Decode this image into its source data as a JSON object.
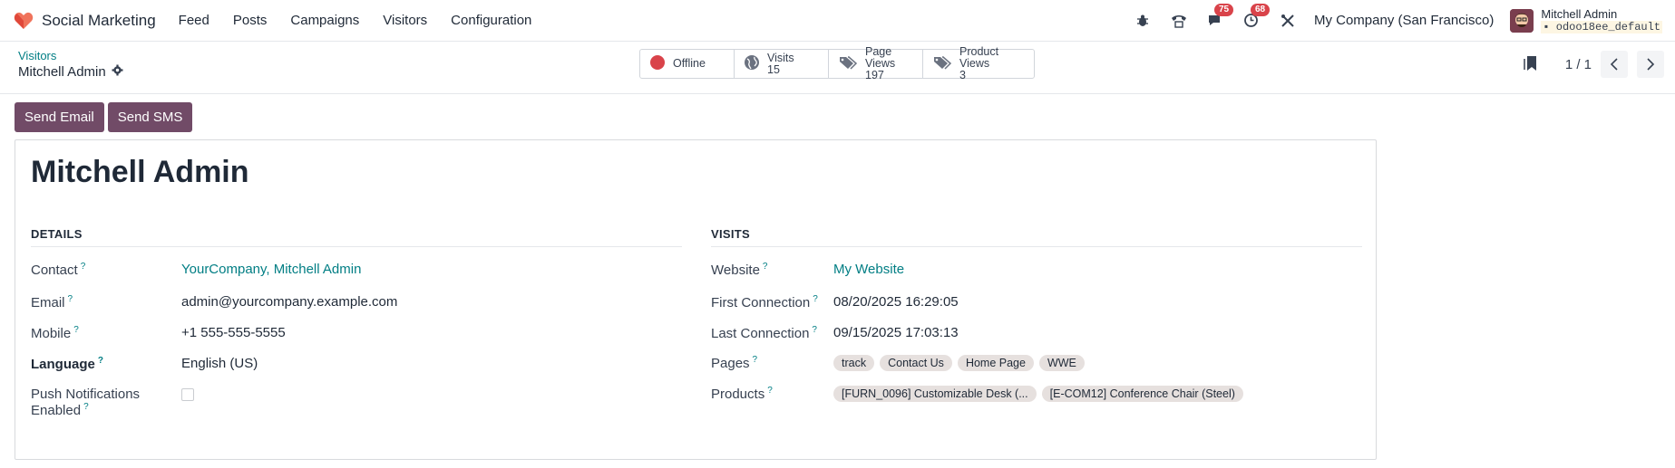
{
  "navbar": {
    "app_name": "Social Marketing",
    "menu": [
      "Feed",
      "Posts",
      "Campaigns",
      "Visitors",
      "Configuration"
    ],
    "chat_badge": "75",
    "activity_badge": "68",
    "company": "My Company (San Francisco)",
    "user_name": "Mitchell Admin",
    "db_name": "odoo18ee_default"
  },
  "breadcrumb": {
    "parent": "Visitors",
    "current": "Mitchell Admin"
  },
  "smart_buttons": {
    "status_label": "Offline",
    "visits_label": "Visits",
    "visits_value": "15",
    "page_views_label": "Page Views",
    "page_views_value": "197",
    "product_views_label": "Product Views",
    "product_views_value": "3"
  },
  "pager": {
    "value": "1 / 1"
  },
  "actions": {
    "send_email": "Send Email",
    "send_sms": "Send SMS"
  },
  "record": {
    "title": "Mitchell Admin",
    "details": {
      "heading": "DETAILS",
      "contact_label": "Contact",
      "contact_value": "YourCompany, Mitchell Admin",
      "email_label": "Email",
      "email_value": "admin@yourcompany.example.com",
      "mobile_label": "Mobile",
      "mobile_value": "+1 555-555-5555",
      "language_label": "Language",
      "language_value": "English (US)",
      "push_label_1": "Push Notifications",
      "push_label_2": "Enabled"
    },
    "visits": {
      "heading": "VISITS",
      "website_label": "Website",
      "website_value": "My Website",
      "first_label": "First Connection",
      "first_value": "08/20/2025 16:29:05",
      "last_label": "Last Connection",
      "last_value": "09/15/2025 17:03:13",
      "pages_label": "Pages",
      "pages": [
        "track",
        "Contact Us",
        "Home Page",
        "WWE"
      ],
      "products_label": "Products",
      "products": [
        "[FURN_0096] Customizable Desk (...",
        "[E-COM12] Conference Chair (Steel)"
      ]
    }
  },
  "colors": {
    "primary": "#714b67",
    "link": "#017e84",
    "status_offline": "#d9434a"
  }
}
